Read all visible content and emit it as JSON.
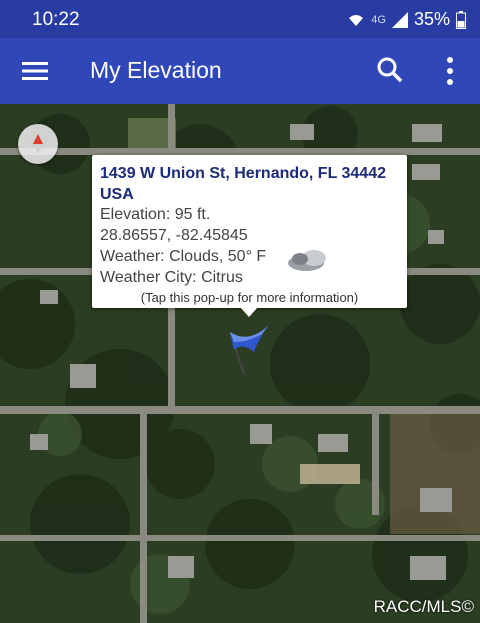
{
  "status": {
    "time": "10:22",
    "network": "4G",
    "battery": "35%"
  },
  "appbar": {
    "title": "My Elevation"
  },
  "icons": [
    "menu-icon",
    "search-icon",
    "more-vert-icon",
    "compass-icon",
    "weather-cloud-icon",
    "map-flag-icon"
  ],
  "popup": {
    "address": "1439 W Union St, Hernando, FL 34442 USA",
    "elevation": "Elevation: 95 ft.",
    "coordinates": "28.86557, -82.45845",
    "weather": "Weather: Clouds,  50° F",
    "weather_city": "Weather City: Citrus",
    "hint": "(Tap this pop-up for more information)"
  },
  "watermark": "RACC/MLS©",
  "colors": {
    "status_bar": "#283ca3",
    "app_bar": "#3047b8",
    "address_text": "#1c2a78"
  }
}
